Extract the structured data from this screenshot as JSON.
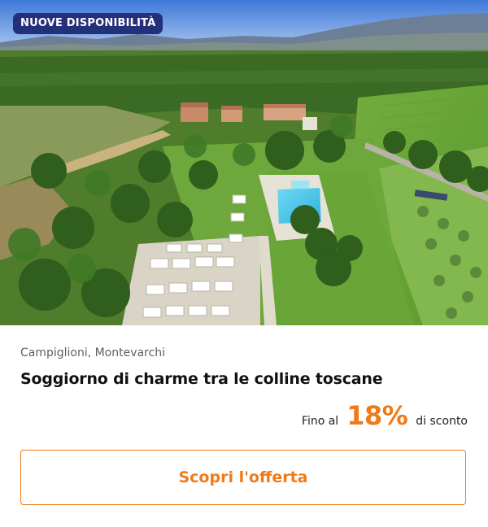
{
  "badge": {
    "label": "NUOVE DISPONIBILITÀ"
  },
  "offer": {
    "location": "Campiglioni, Montevarchi",
    "title": "Soggiorno di charme tra le colline toscane",
    "discount_prefix": "Fino al",
    "discount_value": "18%",
    "discount_suffix": "di sconto"
  },
  "cta": {
    "label": "Scopri l'offerta"
  },
  "colors": {
    "accent": "#f07a18",
    "badge_bg": "#25307a",
    "text": "#111111",
    "muted": "#5f5f5f"
  },
  "icons": {
    "photo": "aerial-landscape-photo"
  }
}
